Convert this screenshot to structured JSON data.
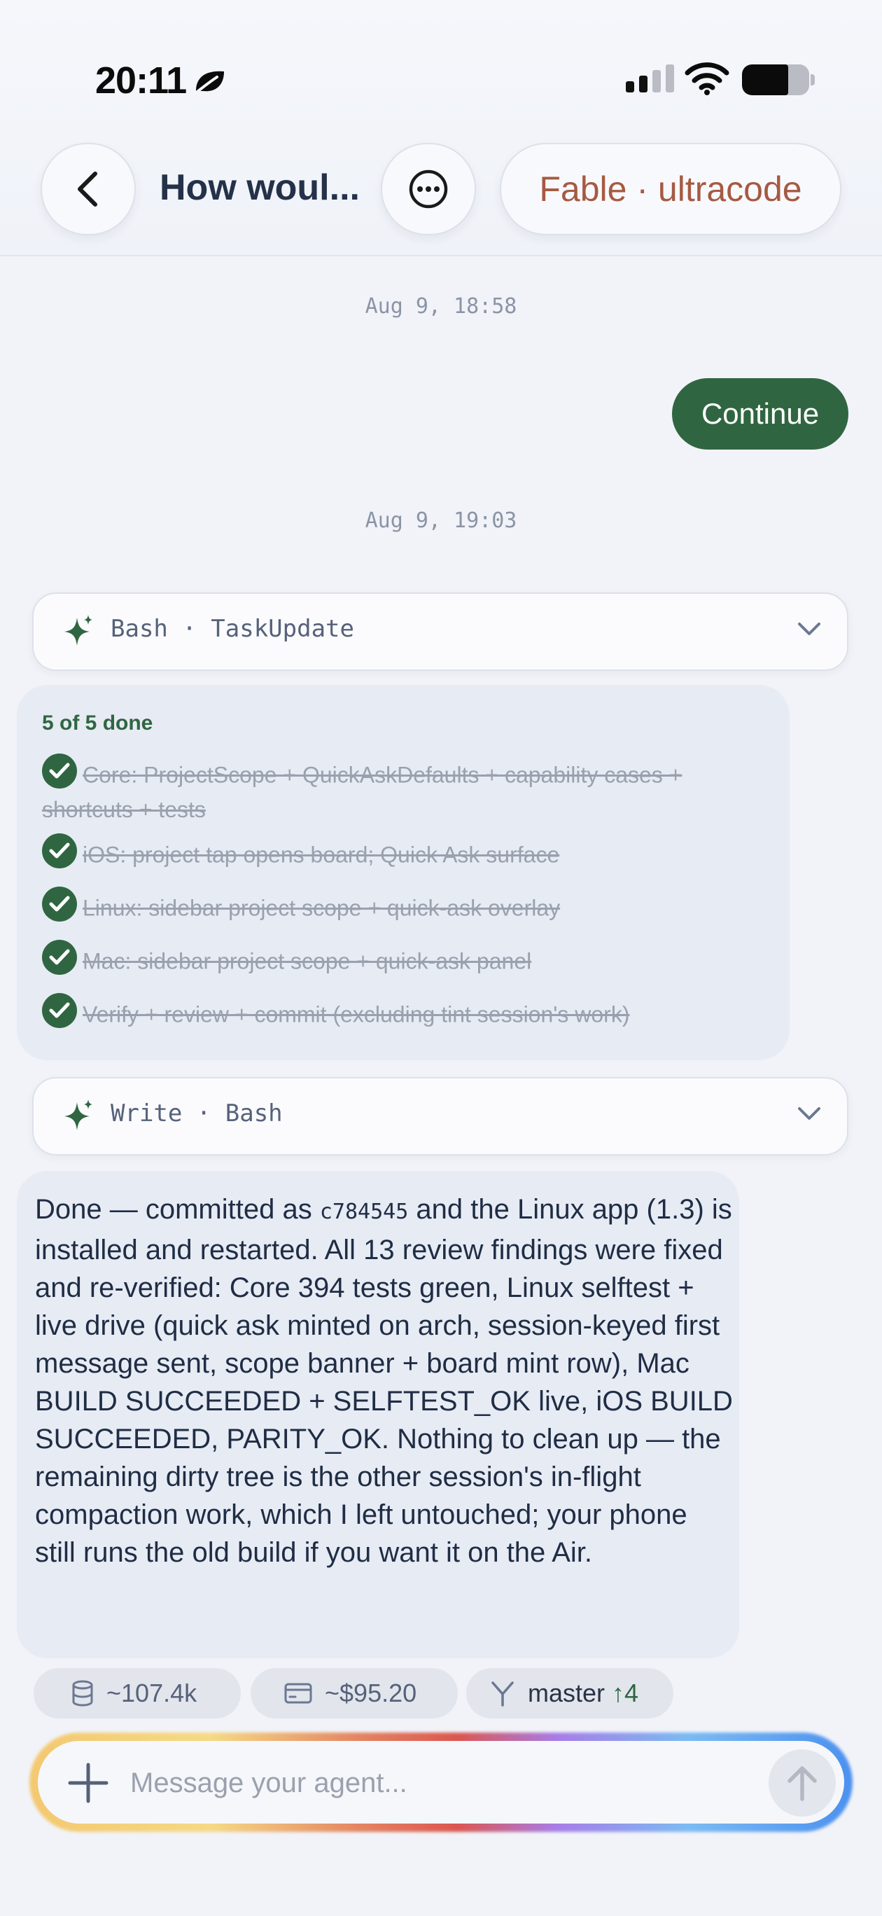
{
  "status_bar": {
    "time": "20:11"
  },
  "header": {
    "title": "How woul...",
    "model": "Fable · ultracode"
  },
  "conversation": {
    "timestamp_1": "Aug 9, 18:58",
    "user_message": "Continue",
    "timestamp_2": "Aug 9, 19:03",
    "tool_card_1": {
      "label": "Bash · TaskUpdate"
    },
    "tasks": {
      "summary": "5 of 5 done",
      "items": [
        "Core: ProjectScope + QuickAskDefaults + capability cases + shortcuts + tests",
        "iOS: project tap opens board; Quick Ask surface",
        "Linux: sidebar project scope + quick-ask overlay",
        "Mac: sidebar project scope + quick-ask panel",
        "Verify + review + commit (excluding tint session's work)"
      ]
    },
    "tool_card_2": {
      "label": "Write · Bash"
    },
    "reply": {
      "before_hash": "Done — committed as ",
      "hash": "c784545",
      "after_hash": " and the Linux app (1.3) is installed and restarted. All 13 review findings were fixed and re-verified: Core 394 tests green, Linux selftest + live drive (quick ask minted on arch, session-keyed first message sent, scope banner + board mint row), Mac BUILD SUCCEEDED + SELFTEST_OK live, iOS BUILD SUCCEEDED, PARITY_OK. Nothing to clean up — the remaining dirty tree is the other session's in-flight compaction work, which I left untouched; your phone still runs the old build if you want it on the Air."
    }
  },
  "chips": {
    "tokens": "~107.4k",
    "cost": "~$95.20",
    "branch": "master",
    "ahead": "↑4"
  },
  "composer": {
    "placeholder": "Message your agent..."
  },
  "colors": {
    "accent_green": "#2f6641",
    "model_text": "#a65a42",
    "background": "#f1f3f8"
  }
}
